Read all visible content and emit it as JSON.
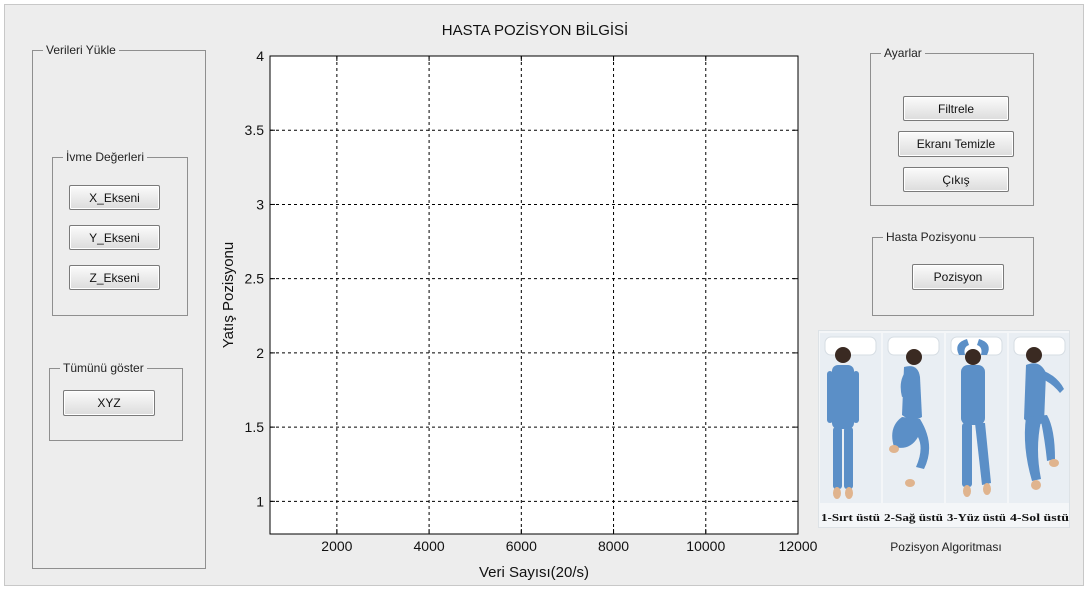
{
  "window": {
    "background": "#ededed"
  },
  "left_panel": {
    "legend": "Verileri Yükle",
    "ivme_group": {
      "legend": "İvme Değerleri",
      "buttons": [
        "X_Ekseni",
        "Y_Ekseni",
        "Z_Ekseni"
      ]
    },
    "tumu_group": {
      "legend": "Tümünü göster",
      "button": "XYZ"
    }
  },
  "chart_data": {
    "type": "line",
    "title": "HASTA POZİSYON BİLGİSİ",
    "xlabel": "Veri Sayısı(20/s)",
    "ylabel": "Yatış Pozisyonu",
    "xlim": [
      550,
      12000
    ],
    "ylim": [
      0.78,
      4.0
    ],
    "xticks": [
      2000,
      4000,
      6000,
      8000,
      10000,
      12000
    ],
    "yticks": [
      1,
      1.5,
      2,
      2.5,
      3,
      3.5,
      4
    ],
    "xticklabels": [
      "2000",
      "4000",
      "6000",
      "8000",
      "10000",
      "12000"
    ],
    "yticklabels": [
      "1",
      "1.5",
      "2",
      "2.5",
      "3",
      "3.5",
      "4"
    ],
    "grid": true,
    "grid_style": "dashed",
    "series": []
  },
  "ayarlar_panel": {
    "legend": "Ayarlar",
    "buttons": [
      "Filtrele",
      "Ekranı Temizle",
      "Çıkış"
    ]
  },
  "hasta_panel": {
    "legend": "Hasta Pozisyonu",
    "button": "Pozisyon"
  },
  "position_image": {
    "labels": [
      "1-Sırt üstü",
      "2-Sağ üstü",
      "3-Yüz üstü",
      "4-Sol üstü"
    ],
    "pajama_color": "#5b8fc7"
  },
  "position_caption": "Pozisyon Algoritması"
}
